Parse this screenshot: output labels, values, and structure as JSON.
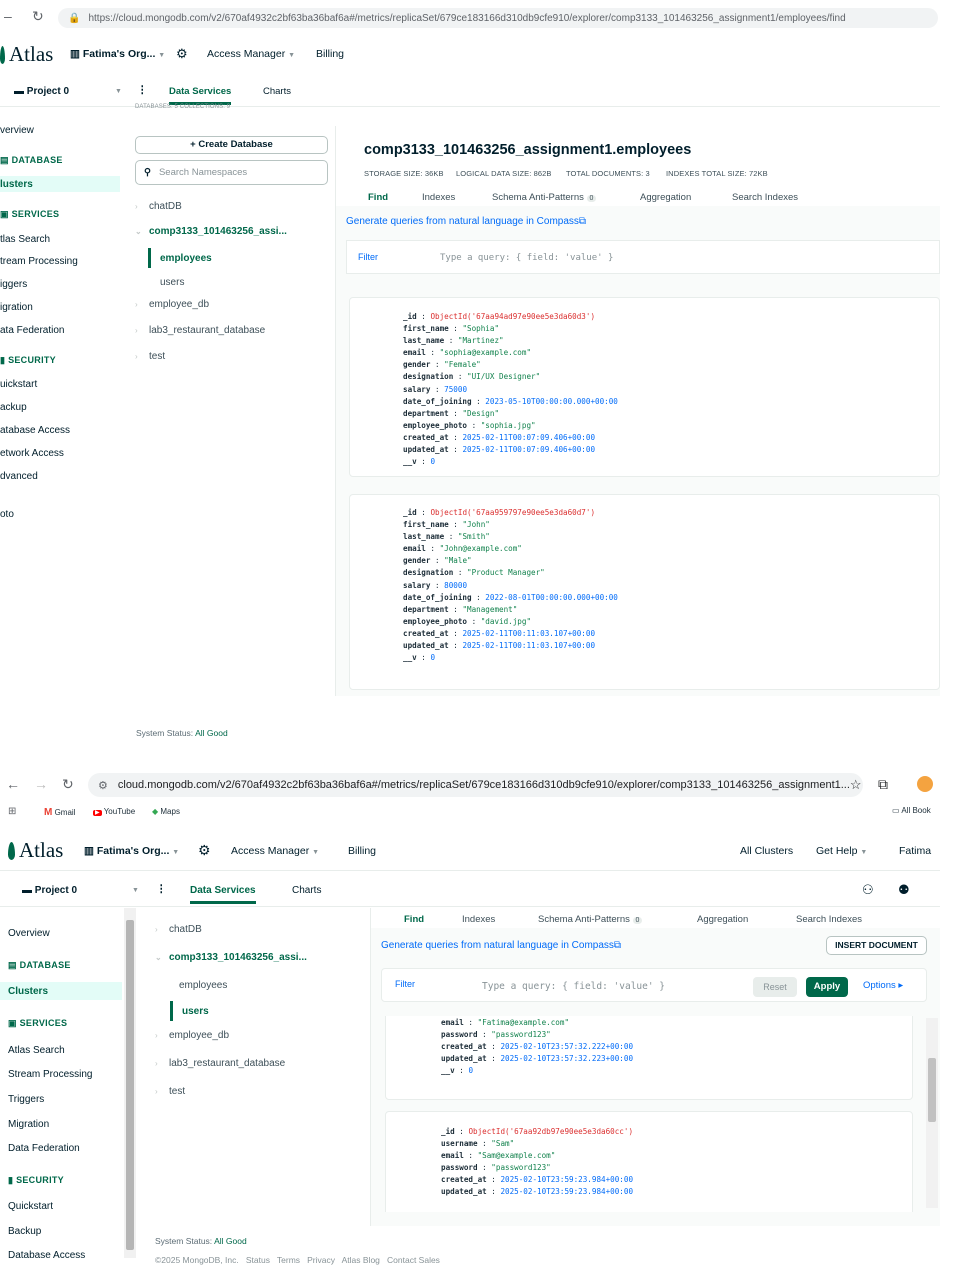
{
  "shot1": {
    "url": "https://cloud.mongodb.com/v2/670af4932c2bf63ba36baf6a#/metrics/replicaSet/679ce183166d310db9cfe910/explorer/comp3133_101463256_assignment1/employees/find",
    "url_host": "cloud.mongodb.com",
    "header": {
      "logo": "Atlas",
      "org": "Fatima's Org...",
      "access": "Access Manager",
      "billing": "Billing"
    },
    "project": "Project 0",
    "tabs": [
      "Data Services",
      "Charts"
    ],
    "cut_text": "DATABASES: 5   COLLECTIONS: 9",
    "sidebar": [
      "verview",
      "DATABASE",
      "lusters",
      "SERVICES",
      "tlas Search",
      "tream Processing",
      "iggers",
      "igration",
      "ata Federation",
      "SECURITY",
      "uickstart",
      "ackup",
      "atabase Access",
      "etwork Access",
      "dvanced",
      "oto"
    ],
    "create_db": "+ Create Database",
    "search_placeholder": "Search Namespaces",
    "dbs": {
      "chat": "chatDB",
      "assign": "comp3133_101463256_assi...",
      "employees": "employees",
      "users": "users",
      "employee_db": "employee_db",
      "lab3": "lab3_restaurant_database",
      "test": "test"
    },
    "ns_title": "comp3133_101463256_assignment1.employees",
    "meta": {
      "storage": "STORAGE SIZE: 36KB",
      "logical": "LOGICAL DATA SIZE: 862B",
      "docs": "TOTAL DOCUMENTS: 3",
      "indexes": "INDEXES TOTAL SIZE: 72KB"
    },
    "find_tabs": [
      "Find",
      "Indexes",
      "Schema Anti-Patterns",
      "Aggregation",
      "Search Indexes"
    ],
    "schema_badge": "0",
    "compass_link": "Generate queries from natural language in Compass",
    "filter": "Filter",
    "query_placeholder": "Type a query: { field: 'value' }",
    "status_label": "System Status:",
    "status_value": "All Good",
    "doc1": [
      [
        "_id",
        "ObjectId('67aa94ad97e90ee5e3da60d3')",
        "oid"
      ],
      [
        "first_name",
        "\"Sophia\"",
        "s"
      ],
      [
        "last_name",
        "\"Martinez\"",
        "s"
      ],
      [
        "email",
        "\"sophia@example.com\"",
        "s"
      ],
      [
        "gender",
        "\"Female\"",
        "s"
      ],
      [
        "designation",
        "\"UI/UX Designer\"",
        "s"
      ],
      [
        "salary",
        "75000",
        "n"
      ],
      [
        "date_of_joining",
        "2023-05-10T00:00:00.000+00:00",
        "n"
      ],
      [
        "department",
        "\"Design\"",
        "s"
      ],
      [
        "employee_photo",
        "\"sophia.jpg\"",
        "s"
      ],
      [
        "created_at",
        "2025-02-11T00:07:09.406+00:00",
        "n"
      ],
      [
        "updated_at",
        "2025-02-11T00:07:09.406+00:00",
        "n"
      ],
      [
        "__v",
        "0",
        "n"
      ]
    ],
    "doc2": [
      [
        "_id",
        "ObjectId('67aa959797e90ee5e3da60d7')",
        "oid"
      ],
      [
        "first_name",
        "\"John\"",
        "s"
      ],
      [
        "last_name",
        "\"Smith\"",
        "s"
      ],
      [
        "email",
        "\"John@example.com\"",
        "s"
      ],
      [
        "gender",
        "\"Male\"",
        "s"
      ],
      [
        "designation",
        "\"Product Manager\"",
        "s"
      ],
      [
        "salary",
        "80000",
        "n"
      ],
      [
        "date_of_joining",
        "2022-08-01T00:00:00.000+00:00",
        "n"
      ],
      [
        "department",
        "\"Management\"",
        "s"
      ],
      [
        "employee_photo",
        "\"david.jpg\"",
        "s"
      ],
      [
        "created_at",
        "2025-02-11T00:11:03.107+00:00",
        "n"
      ],
      [
        "updated_at",
        "2025-02-11T00:11:03.107+00:00",
        "n"
      ],
      [
        "__v",
        "0",
        "n"
      ]
    ]
  },
  "shot2": {
    "url": "cloud.mongodb.com/v2/670af4932c2bf63ba36baf6a#/metrics/replicaSet/679ce183166d310db9cfe910/explorer/comp3133_101463256_assignment1...",
    "bookmarks": [
      "Gmail",
      "YouTube",
      "Maps"
    ],
    "all_bookmarks": "All Book",
    "header": {
      "logo": "Atlas",
      "org": "Fatima's Org...",
      "access": "Access Manager",
      "billing": "Billing",
      "clusters": "All Clusters",
      "help": "Get Help",
      "user": "Fatima"
    },
    "project": "Project 0",
    "tabs": [
      "Data Services",
      "Charts"
    ],
    "sidebar": {
      "overview": "Overview",
      "database": "DATABASE",
      "clusters": "Clusters",
      "services": "SERVICES",
      "atlas_search": "Atlas Search",
      "stream": "Stream Processing",
      "triggers": "Triggers",
      "migration": "Migration",
      "federation": "Data Federation",
      "security": "SECURITY",
      "quickstart": "Quickstart",
      "backup": "Backup",
      "db_access": "Database Access"
    },
    "dbs": {
      "chat": "chatDB",
      "assign": "comp3133_101463256_assi...",
      "employees": "employees",
      "users": "users",
      "employee_db": "employee_db",
      "lab3": "lab3_restaurant_database",
      "test": "test"
    },
    "find_tabs": [
      "Find",
      "Indexes",
      "Schema Anti-Patterns",
      "Aggregation",
      "Search Indexes"
    ],
    "schema_badge": "0",
    "compass_link": "Generate queries from natural language in Compass",
    "insert": "INSERT DOCUMENT",
    "filter": "Filter",
    "query_placeholder": "Type a query: { field: 'value' }",
    "reset": "Reset",
    "apply": "Apply",
    "options": "Options ▸",
    "doc_partial": [
      [
        "email",
        "\"Fatima@example.com\"",
        "s"
      ],
      [
        "password",
        "\"password123\"",
        "s"
      ],
      [
        "created_at",
        "2025-02-10T23:57:32.222+00:00",
        "n"
      ],
      [
        "updated_at",
        "2025-02-10T23:57:32.223+00:00",
        "n"
      ],
      [
        "__v",
        "0",
        "n"
      ]
    ],
    "doc_next": [
      [
        "_id",
        "ObjectId('67aa92db97e90ee5e3da60cc')",
        "oid"
      ],
      [
        "username",
        "\"Sam\"",
        "s"
      ],
      [
        "email",
        "\"Sam@example.com\"",
        "s"
      ],
      [
        "password",
        "\"password123\"",
        "s"
      ],
      [
        "created_at",
        "2025-02-10T23:59:23.984+00:00",
        "n"
      ],
      [
        "updated_at",
        "2025-02-10T23:59:23.984+00:00",
        "n"
      ]
    ],
    "status_label": "System Status:",
    "status_value": "All Good",
    "footer": [
      "©2025 MongoDB, Inc.",
      "Status",
      "Terms",
      "Privacy",
      "Atlas Blog",
      "Contact Sales"
    ]
  }
}
